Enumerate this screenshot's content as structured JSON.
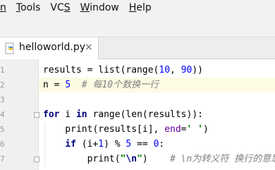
{
  "menubar": {
    "items": [
      {
        "label": "n",
        "mnemonic": "n"
      },
      {
        "label": "Tools",
        "mnemonic": "T"
      },
      {
        "label": "VCS",
        "mnemonic": "S"
      },
      {
        "label": "Window",
        "mnemonic": "W"
      },
      {
        "label": "Help",
        "mnemonic": "H"
      }
    ]
  },
  "tab": {
    "filename": "helloworld.py",
    "close": "×",
    "icon": "python-file-icon"
  },
  "editor": {
    "line_numbers": [
      "1",
      "2",
      "3",
      "4",
      "5",
      "6",
      "7"
    ],
    "lines": [
      {
        "segments": [
          {
            "t": "results = list(range(",
            "c": ""
          },
          {
            "t": "10",
            "c": "num"
          },
          {
            "t": ", ",
            "c": ""
          },
          {
            "t": "90",
            "c": "num"
          },
          {
            "t": "))",
            "c": ""
          }
        ]
      },
      {
        "segments": [
          {
            "t": "n = ",
            "c": ""
          },
          {
            "t": "5",
            "c": "num"
          },
          {
            "t": "  # 每10个数换一行",
            "c": "cmt"
          }
        ]
      },
      {
        "segments": []
      },
      {
        "segments": [
          {
            "t": "for",
            "c": "kw"
          },
          {
            "t": " i ",
            "c": ""
          },
          {
            "t": "in",
            "c": "kw"
          },
          {
            "t": " range(len(results)):",
            "c": ""
          }
        ]
      },
      {
        "segments": [
          {
            "t": "    print(results[i], ",
            "c": ""
          },
          {
            "t": "end",
            "c": "kwarg"
          },
          {
            "t": "=",
            "c": ""
          },
          {
            "t": "' '",
            "c": "str"
          },
          {
            "t": ")",
            "c": ""
          }
        ]
      },
      {
        "segments": [
          {
            "t": "    ",
            "c": ""
          },
          {
            "t": "if",
            "c": "kw"
          },
          {
            "t": " (i+",
            "c": ""
          },
          {
            "t": "1",
            "c": "num"
          },
          {
            "t": ") % ",
            "c": ""
          },
          {
            "t": "5",
            "c": "num"
          },
          {
            "t": " == ",
            "c": ""
          },
          {
            "t": "0",
            "c": "num"
          },
          {
            "t": ":",
            "c": ""
          }
        ]
      },
      {
        "segments": [
          {
            "t": "        print(",
            "c": ""
          },
          {
            "t": "\"",
            "c": "str"
          },
          {
            "t": "\\n",
            "c": "esc"
          },
          {
            "t": "\"",
            "c": "str"
          },
          {
            "t": ")    ",
            "c": ""
          },
          {
            "t": "# \\n为转义符 换行的意思",
            "c": "cmt"
          }
        ]
      }
    ],
    "current_line": 2
  },
  "colors": {
    "menubar_bg": "#f2f2f2",
    "gutter_bg": "#f0f0f0",
    "current_line_bg": "#fdfbe3",
    "keyword": "#000080",
    "number": "#0000ff",
    "string": "#008000",
    "comment": "#808080"
  }
}
